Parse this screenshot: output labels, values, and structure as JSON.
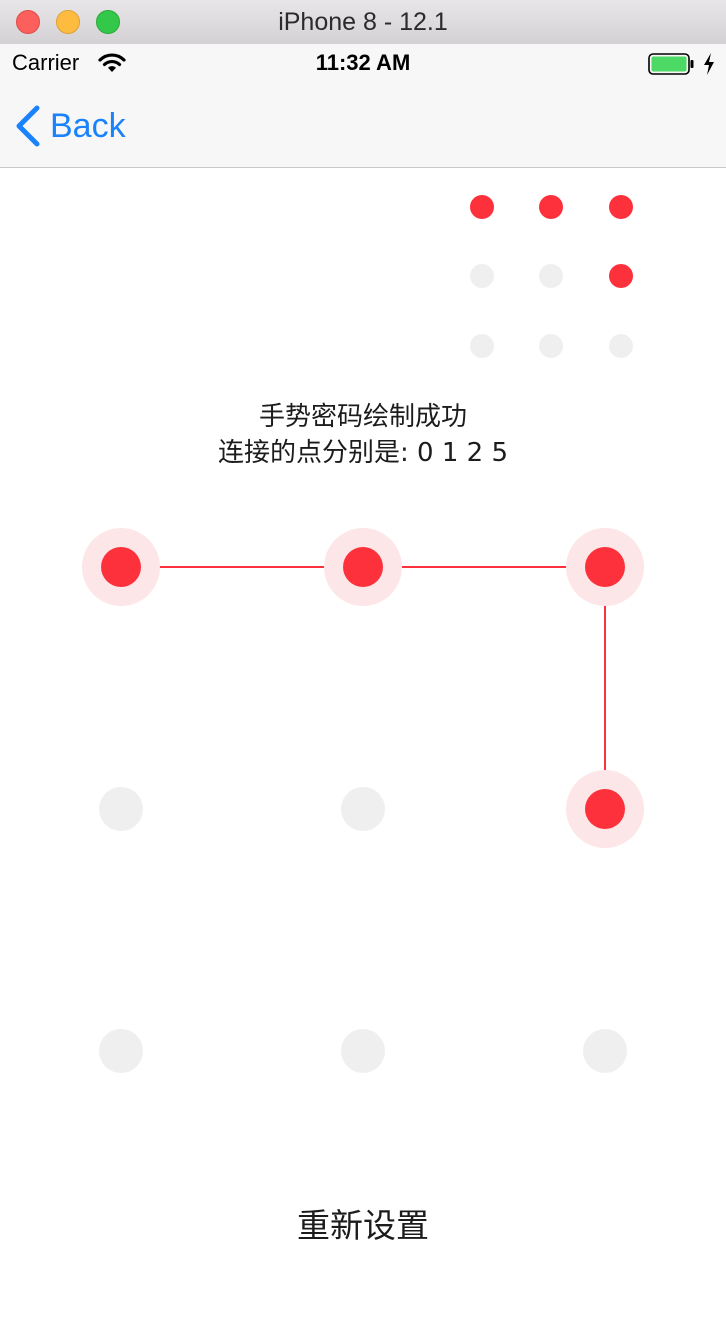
{
  "window": {
    "title": "iPhone 8 - 12.1"
  },
  "status_bar": {
    "carrier": "Carrier",
    "time": "11:32 AM"
  },
  "nav": {
    "back_label": "Back"
  },
  "message": {
    "line1": "手势密码绘制成功",
    "line2": "连接的点分别是: 0 1 2 5"
  },
  "pattern": {
    "sequence": [
      0,
      1,
      2,
      5
    ]
  },
  "reset_label": "重新设置",
  "colors": {
    "active": "#fd313c",
    "active_halo": "#fde6e8",
    "inactive": "#efefef",
    "tint": "#1a82fb"
  }
}
